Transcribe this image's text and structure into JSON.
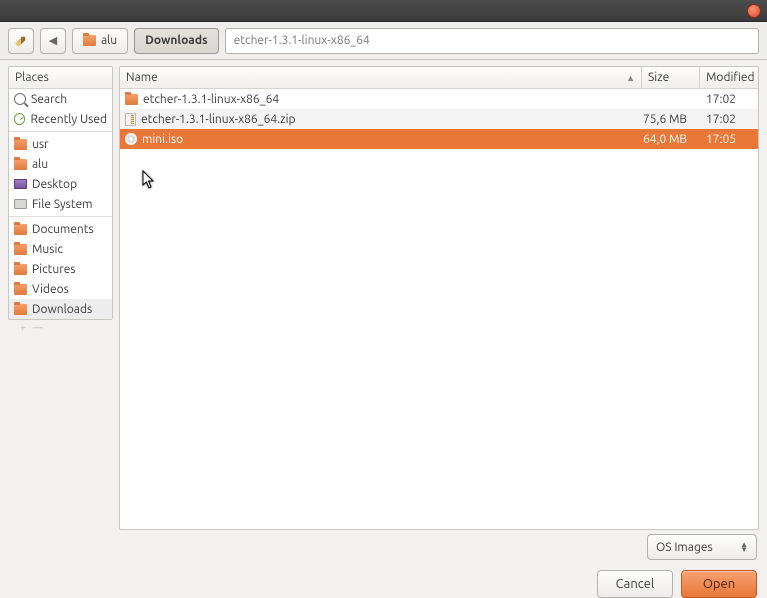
{
  "toolbar": {
    "path_user": "alu",
    "path_current": "Downloads",
    "location_text": "etcher-1.3.1-linux-x86_64"
  },
  "places": {
    "header": "Places",
    "group1": [
      {
        "label": "Search",
        "icon": "search"
      },
      {
        "label": "Recently Used",
        "icon": "clock"
      }
    ],
    "group2": [
      {
        "label": "usr",
        "icon": "folder"
      },
      {
        "label": "alu",
        "icon": "folder"
      },
      {
        "label": "Desktop",
        "icon": "desktop"
      },
      {
        "label": "File System",
        "icon": "hd"
      }
    ],
    "group3": [
      {
        "label": "Documents",
        "icon": "folder"
      },
      {
        "label": "Music",
        "icon": "folder"
      },
      {
        "label": "Pictures",
        "icon": "folder"
      },
      {
        "label": "Videos",
        "icon": "folder"
      },
      {
        "label": "Downloads",
        "icon": "folder",
        "current": true
      }
    ]
  },
  "columns": {
    "name": "Name",
    "size": "Size",
    "modified": "Modified"
  },
  "files": [
    {
      "name": "etcher-1.3.1-linux-x86_64",
      "icon": "folder",
      "size": "",
      "mod": "17:02",
      "alt": false,
      "sel": false
    },
    {
      "name": "etcher-1.3.1-linux-x86_64.zip",
      "icon": "zip",
      "size": "75,6 MB",
      "mod": "17:02",
      "alt": true,
      "sel": false
    },
    {
      "name": "mini.iso",
      "icon": "disc",
      "size": "64,0 MB",
      "mod": "17:05",
      "alt": false,
      "sel": true
    }
  ],
  "filter": {
    "label": "OS Images"
  },
  "buttons": {
    "cancel": "Cancel",
    "open": "Open"
  }
}
